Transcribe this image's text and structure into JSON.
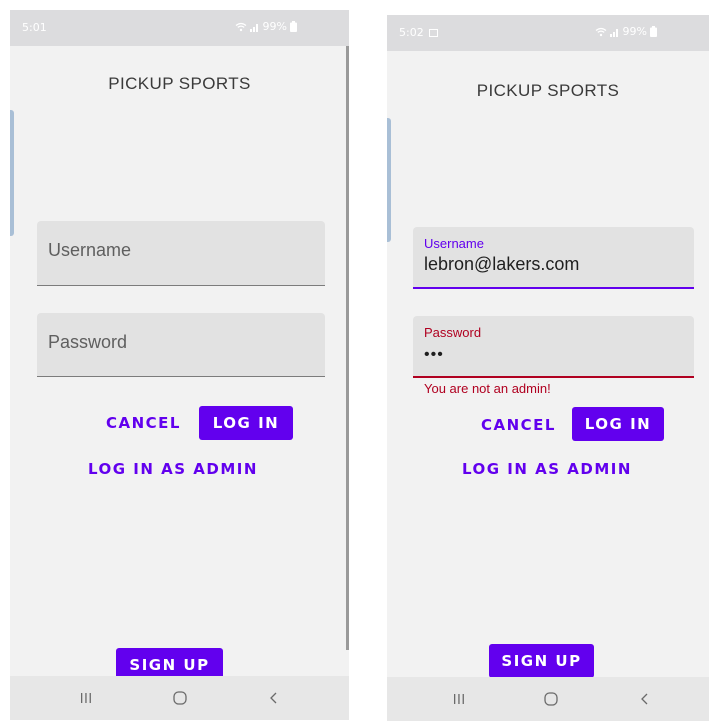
{
  "colors": {
    "accent": "#6200ee",
    "error": "#b00020",
    "field_background": "#e2e2e2",
    "screen_background": "#f2f2f2"
  },
  "left_screen": {
    "status_bar": {
      "time": "5:01",
      "battery": "99%",
      "icons": [
        "wifi-icon",
        "signal-icon",
        "battery-icon"
      ]
    },
    "app_title": "PICKUP SPORTS",
    "username_field": {
      "placeholder": "Username",
      "value": ""
    },
    "password_field": {
      "placeholder": "Password",
      "value": ""
    },
    "cancel_label": "CANCEL",
    "login_label": "LOG IN",
    "admin_login_label": "LOG IN AS ADMIN",
    "signup_label": "SIGN UP",
    "nav_bar": [
      "recent-apps-icon",
      "home-icon",
      "back-icon"
    ]
  },
  "right_screen": {
    "status_bar": {
      "time": "5:02",
      "battery": "99%",
      "icons": [
        "image-notification-icon",
        "wifi-icon",
        "signal-icon",
        "battery-icon"
      ]
    },
    "app_title": "PICKUP SPORTS",
    "username_field": {
      "label": "Username",
      "value": "lebron@lakers.com"
    },
    "password_field": {
      "label": "Password",
      "value": "•••"
    },
    "error_message": "You are not an admin!",
    "cancel_label": "CANCEL",
    "login_label": "LOG IN",
    "admin_login_label": "LOG IN AS ADMIN",
    "signup_label": "SIGN UP",
    "nav_bar": [
      "recent-apps-icon",
      "home-icon",
      "back-icon"
    ]
  }
}
